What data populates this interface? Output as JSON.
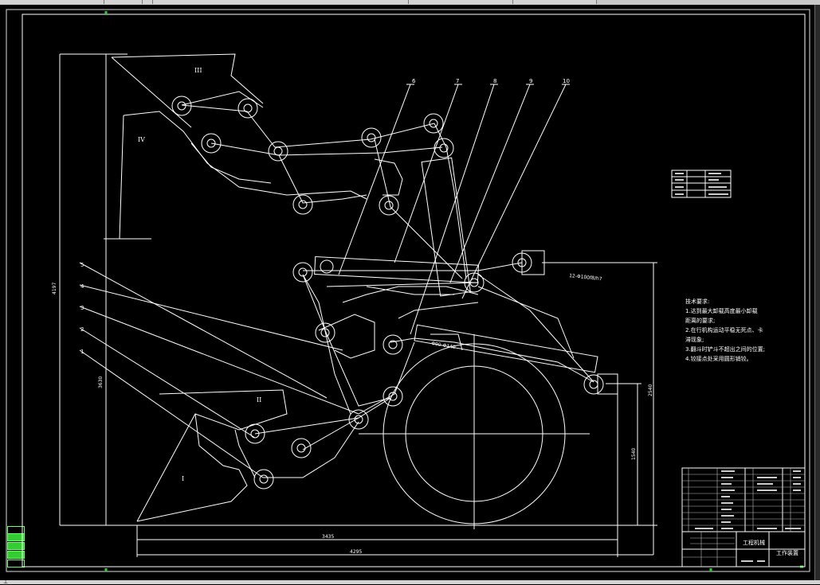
{
  "drawing": {
    "region_labels": [
      "III",
      "IV",
      "II",
      "I"
    ],
    "callout_numbers_top": [
      "6",
      "7",
      "8",
      "9",
      "10"
    ],
    "callout_numbers_left": [
      "5",
      "4",
      "3",
      "2",
      "1"
    ],
    "dimensions": {
      "vertical_total": "4197",
      "vertical_mid": "3630",
      "right_height": "2540",
      "right_lower": "1540",
      "base_length": "3435",
      "total_length": "4295"
    },
    "pin_label": "12-Φ100f8/h7",
    "cylinder_label": "Φ90-Φ140",
    "tech_requirements": {
      "title": "技术要求:",
      "lines": [
        "1.达到最大卸载高度最小卸载",
        "距离的要求;",
        "2.在行机构运动平稳无死点、卡",
        "滞现象;",
        "3.翻斗时铲斗不超出之间的位置;",
        "4.铰接点处采用圆形销铰。"
      ]
    },
    "title_block": {
      "school": "工程机械",
      "drawing_name": "工作装置"
    }
  },
  "colors": {
    "background": "#000000",
    "lines": "#ffffff",
    "status_green": "#33cc33"
  }
}
